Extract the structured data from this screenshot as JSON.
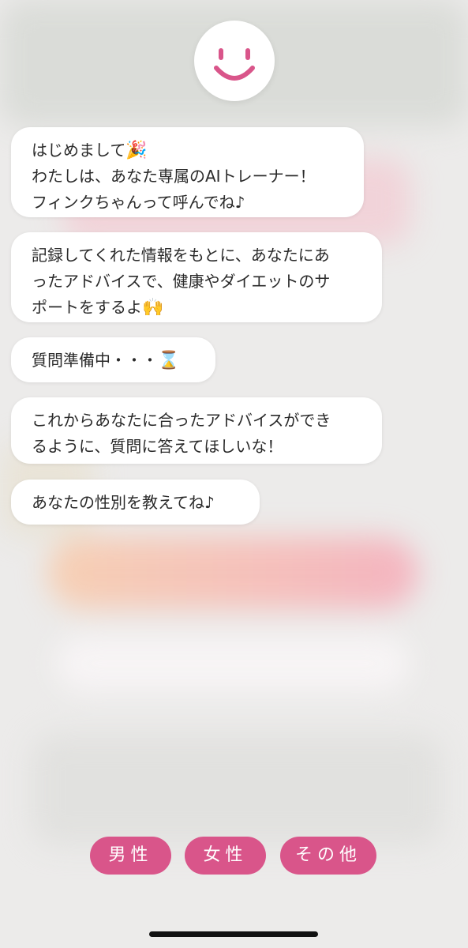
{
  "assistant": {
    "avatar_icon": "smiley-face-icon",
    "accent_color": "#d9558a"
  },
  "messages": [
    {
      "lines": [
        "はじめまして",
        "わたしは、あなた専属のAIトレーナー！",
        "フィンクちゃんって呼んでね♪"
      ],
      "emoji": "🎉"
    },
    {
      "lines": [
        "記録してくれた情報をもとに、あなたにあ",
        "ったアドバイスで、健康やダイエットのサ",
        "ポートをするよ"
      ],
      "emoji": "🙌"
    },
    {
      "lines": [
        "質問準備中・・・"
      ],
      "emoji": "⌛"
    },
    {
      "lines": [
        "これからあなたに合ったアドバイスができ",
        "るように、質問に答えてほしいな！"
      ]
    },
    {
      "lines": [
        "あなたの性別を教えてね♪"
      ]
    }
  ],
  "choices": [
    "男性",
    "女性",
    "その他"
  ]
}
